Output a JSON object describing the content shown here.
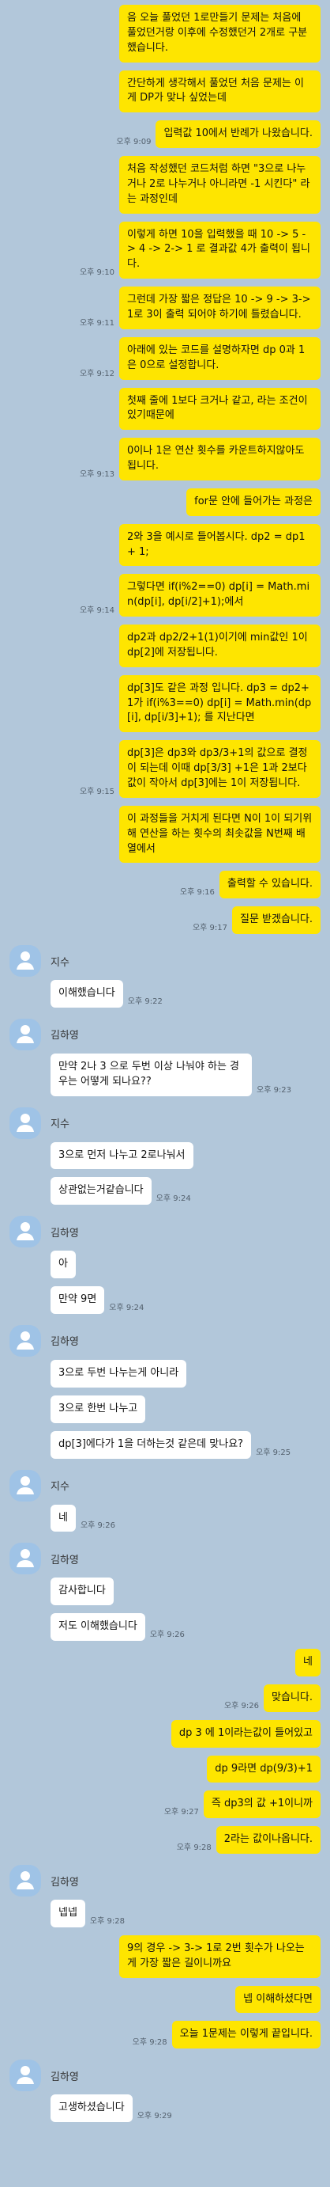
{
  "messages": [
    {
      "side": "me",
      "text": "음 오늘 풀었던 1로만들기 문제는 처음에 풀었던거랑 이후에 수정했던거 2개로 구분했습니다.",
      "time": ""
    },
    {
      "side": "me",
      "text": "간단하게 생각해서 풀었던 처음 문제는 이게 DP가 맞나 싶었는데",
      "time": ""
    },
    {
      "side": "me",
      "text": "입력값 10에서 반례가 나왔습니다.",
      "time": "오후 9:09"
    },
    {
      "side": "me",
      "text": "처음 작성했던 코드처럼 하면 \"3으로 나누거나 2로 나누거나 아니라면 -1 시킨다\" 라는 과정인데",
      "time": ""
    },
    {
      "side": "me",
      "text": "이렇게 하면 10을 입력했을 때 10 -> 5 -> 4 -> 2-> 1 로 결과값 4가 출력이 됩니다.",
      "time": "오후 9:10"
    },
    {
      "side": "me",
      "text": "그런데 가장 짧은 정답은 10 -> 9 -> 3-> 1로 3이 출력 되어야 하기에 틀렸습니다.",
      "time": "오후 9:11"
    },
    {
      "side": "me",
      "text": "아래에 있는 코드를 설명하자면 dp 0과 1은 0으로 설정합니다.",
      "time": "오후 9:12"
    },
    {
      "side": "me",
      "text": "첫째 줄에 1보다 크거나 같고, 라는 조건이 있기때문에",
      "time": ""
    },
    {
      "side": "me",
      "text": "0이나 1은 연산 횟수를 카운트하지않아도 됩니다.",
      "time": "오후 9:13"
    },
    {
      "side": "me",
      "text": "for문 안에 들어가는 과정은",
      "time": ""
    },
    {
      "side": "me",
      "text": "2와 3을 예시로 들어봅시다. dp2 = dp1 + 1;",
      "time": ""
    },
    {
      "side": "me",
      "text": "그렇다면 if(i%2==0) dp[i] = Math.min(dp[i], dp[i/2]+1);에서",
      "time": "오후 9:14"
    },
    {
      "side": "me",
      "text": "dp2과 dp2/2+1(1)이기에 min값인 1이 dp[2]에 저장됩니다.",
      "time": ""
    },
    {
      "side": "me",
      "text": "dp[3]도 같은 과정 입니다. dp3 = dp2+1가 if(i%3==0) dp[i] = Math.min(dp[i], dp[i/3]+1); 를 지난다면",
      "time": ""
    },
    {
      "side": "me",
      "text": "dp[3]은 dp3와 dp3/3+1의 값으로 결정이 되는데 이때 dp[3/3] +1은 1과 2보다 값이 작아서 dp[3]에는 1이 저장됩니다.",
      "time": "오후 9:15"
    },
    {
      "side": "me",
      "text": "이 과정들을 거치게 된다면 N이 1이 되기위해 연산을 하는 횟수의 최솟값을 N번째 배열에서",
      "time": ""
    },
    {
      "side": "me",
      "text": "출력할 수 있습니다.",
      "time": "오후 9:16"
    },
    {
      "side": "me",
      "text": "질문 받겠습니다.",
      "time": "오후 9:17"
    },
    {
      "side": "them",
      "author": "지수",
      "text": "이해했습니다",
      "time": "오후 9:22"
    },
    {
      "side": "them",
      "author": "김하영",
      "text": "만약 2나 3 으로 두번 이상 나눠야 하는 경우는 어떻게 되나요??",
      "time": "오후 9:23"
    },
    {
      "side": "them",
      "author": "지수",
      "text": "3으로 먼저 나누고 2로나눠서",
      "time": ""
    },
    {
      "side": "them",
      "text": "상관없는거같습니다",
      "time": "오후 9:24"
    },
    {
      "side": "them",
      "author": "김하영",
      "text": "아",
      "time": ""
    },
    {
      "side": "them",
      "text": "만약 9면",
      "time": "오후 9:24"
    },
    {
      "side": "them",
      "author": "김하영",
      "text": "3으로 두번 나누는게 아니라",
      "time": ""
    },
    {
      "side": "them",
      "text": "3으로 한번 나누고",
      "time": ""
    },
    {
      "side": "them",
      "text": "dp[3]에다가 1을 더하는것 같은데 맞나요?",
      "time": "오후 9:25"
    },
    {
      "side": "them",
      "author": "지수",
      "text": "네",
      "time": "오후 9:26"
    },
    {
      "side": "them",
      "author": "김하영",
      "text": "감사합니다",
      "time": ""
    },
    {
      "side": "them",
      "text": "저도 이해했습니다",
      "time": "오후 9:26"
    },
    {
      "side": "me",
      "text": "네",
      "time": ""
    },
    {
      "side": "me",
      "text": "맞습니다.",
      "time": "오후 9:26"
    },
    {
      "side": "me",
      "text": "dp 3 에 1이라는값이 들어있고",
      "time": ""
    },
    {
      "side": "me",
      "text": "dp 9라면 dp(9/3)+1",
      "time": ""
    },
    {
      "side": "me",
      "text": "즉 dp3의 값 +1이니까",
      "time": "오후 9:27"
    },
    {
      "side": "me",
      "text": "2라는 값이나옵니다.",
      "time": "오후 9:28"
    },
    {
      "side": "them",
      "author": "김하영",
      "text": "넵넵",
      "time": "오후 9:28"
    },
    {
      "side": "me",
      "text": "9의 경우 -> 3-> 1로 2번 횟수가 나오는게 가장 짧은 길이니까요",
      "time": ""
    },
    {
      "side": "me",
      "text": "넵 이해하셨다면",
      "time": ""
    },
    {
      "side": "me",
      "text": "오늘 1문제는 이렇게 끝입니다.",
      "time": "오후 9:28"
    },
    {
      "side": "them",
      "author": "김하영",
      "text": "고생하셨습니다",
      "time": "오후 9:29"
    }
  ]
}
